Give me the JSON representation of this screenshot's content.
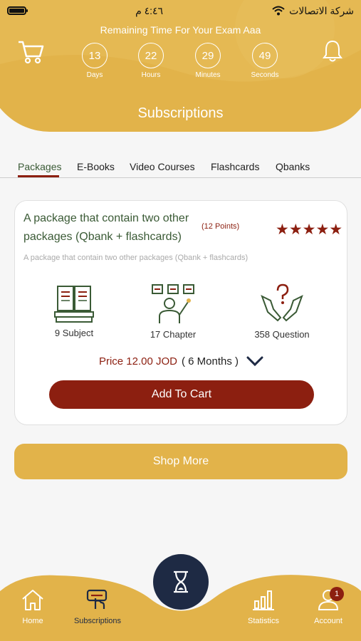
{
  "status_bar": {
    "carrier": "شركة الاتصالات",
    "time": "٤:٤٦ م"
  },
  "header": {
    "remaining_text": "Remaining Time For Your Exam Aaa",
    "timers": [
      {
        "value": "13",
        "unit": "Days"
      },
      {
        "value": "22",
        "unit": "Hours"
      },
      {
        "value": "29",
        "unit": "Minutes"
      },
      {
        "value": "49",
        "unit": "Seconds"
      }
    ],
    "title": "Subscriptions"
  },
  "tabs": [
    "Packages",
    "E-Books",
    "Video Courses",
    "Flashcards",
    "Qbanks"
  ],
  "package": {
    "title": "A package that contain two other packages (Qbank + flashcards)",
    "points": "(12 Points)",
    "stars": "★★★★★",
    "rating": 5,
    "description": "A package that contain two other packages (Qbank + flashcards)",
    "stats": [
      {
        "label": "9 Subject",
        "icon": "books-icon"
      },
      {
        "label": "17 Chapter",
        "icon": "teacher-icon"
      },
      {
        "label": "358 Question",
        "icon": "question-hands-icon"
      }
    ],
    "price": "Price 12.00 JOD",
    "duration": "( 6 Months )",
    "add_to_cart": "Add To Cart"
  },
  "shop_more": "Shop More",
  "nav": {
    "home": "Home",
    "subscriptions": "Subscriptions",
    "statistics": "Statistics",
    "account": "Account",
    "badge": "1"
  },
  "colors": {
    "accent": "#e2b34a",
    "primary": "#8c1f10",
    "title_green": "#3a5a35",
    "center_button": "#1e2a44"
  }
}
